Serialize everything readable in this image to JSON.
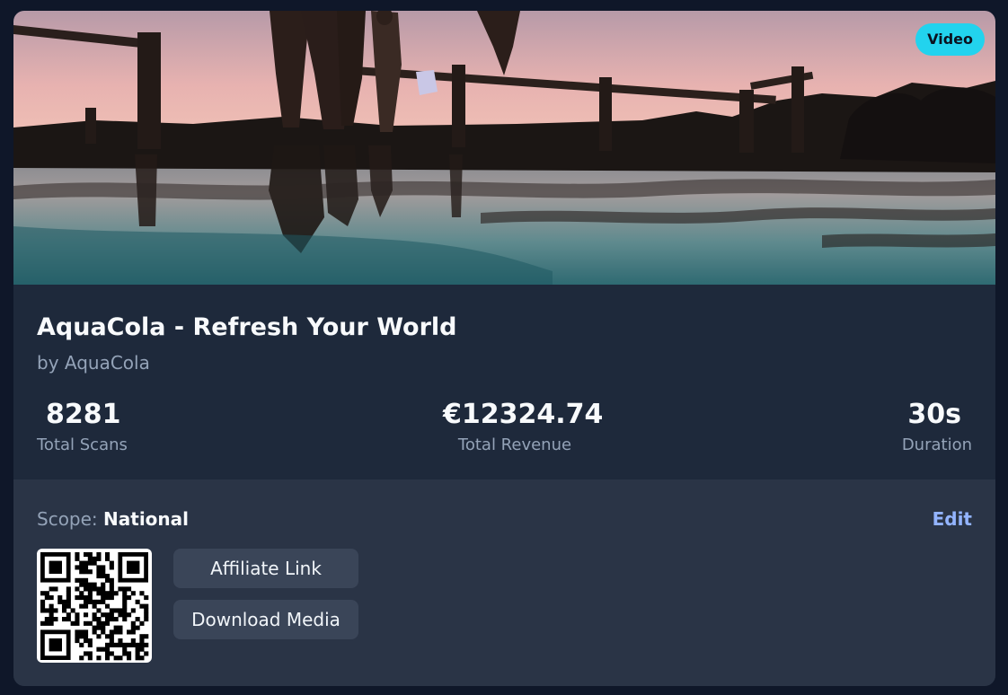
{
  "badge": {
    "label": "Video"
  },
  "campaign": {
    "title": "AquaCola - Refresh Your World",
    "byline": "by AquaCola"
  },
  "stats": {
    "total_scans": {
      "value": "8281",
      "label": "Total Scans"
    },
    "total_revenue": {
      "value": "€12324.74",
      "label": "Total Revenue"
    },
    "duration": {
      "value": "30s",
      "label": "Duration"
    }
  },
  "scope": {
    "label": "Scope:",
    "value": "National"
  },
  "actions": {
    "edit_label": "Edit",
    "affiliate_label": "Affiliate Link",
    "download_label": "Download Media"
  },
  "colors": {
    "page_bg": "#0f1729",
    "card_bg": "#1e293b",
    "footer_bg": "#2a3446",
    "badge_accent": "#22d3ee",
    "link_accent": "#93b4ff",
    "button_bg": "#3a4558"
  },
  "icons": {
    "qr": "qr-code-image"
  }
}
